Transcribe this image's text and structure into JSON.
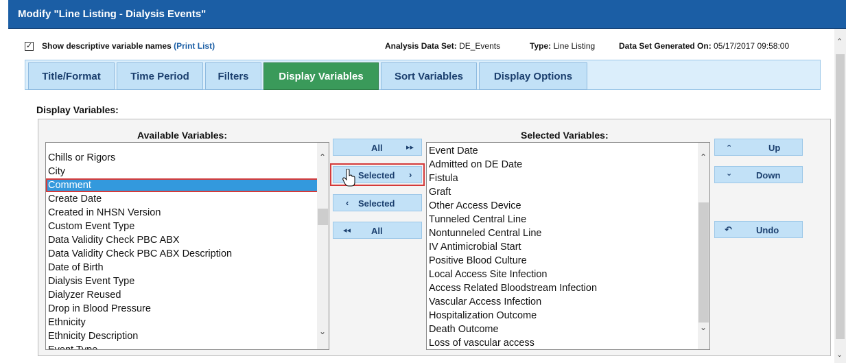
{
  "window": {
    "title": "Modify \"Line Listing - Dialysis Events\""
  },
  "infobar": {
    "checkbox_label": "Show descriptive variable names",
    "print_link": "(Print List)",
    "dataset_label": "Analysis Data Set:",
    "dataset_value": "DE_Events",
    "type_label": "Type:",
    "type_value": "Line Listing",
    "generated_label": "Data Set Generated On:",
    "generated_value": "05/17/2017 09:58:00"
  },
  "tabs": [
    {
      "label": "Title/Format"
    },
    {
      "label": "Time Period"
    },
    {
      "label": "Filters"
    },
    {
      "label": "Display Variables"
    },
    {
      "label": "Sort Variables"
    },
    {
      "label": "Display Options"
    }
  ],
  "section": {
    "title": "Display Variables:"
  },
  "available": {
    "title": "Available Variables:",
    "items": [
      "Chills or Rigors",
      "City",
      "Comment",
      "Create Date",
      "Created in NHSN Version",
      "Custom Event Type",
      "Data Validity Check PBC ABX",
      "Data Validity Check PBC ABX Description",
      "Date of Birth",
      "Dialysis Event Type",
      "Dialyzer Reused",
      "Drop in Blood Pressure",
      "Ethnicity",
      "Ethnicity Description",
      "Event Type"
    ],
    "selected_item": "Comment"
  },
  "transfer": {
    "all_right": "All",
    "selected_right": "Selected",
    "selected_left": "Selected",
    "all_left": "All"
  },
  "selected": {
    "title": "Selected Variables:",
    "items": [
      "Event Date",
      "Admitted on DE Date",
      "Fistula",
      "Graft",
      "Other Access Device",
      "Tunneled Central Line",
      "Nontunneled Central Line",
      "IV Antimicrobial Start",
      "Positive Blood Culture",
      "Local Access Site Infection",
      "Access Related Bloodstream Infection",
      "Vascular Access Infection",
      "Hospitalization Outcome",
      "Death Outcome",
      "Loss of vascular access"
    ]
  },
  "order": {
    "up": "Up",
    "down": "Down",
    "undo": "Undo"
  },
  "colors": {
    "header_blue": "#1b5ea5",
    "active_tab": "#3a9a5a",
    "tab_bg": "#c2e1f7",
    "selection": "#3399dd",
    "highlight_red": "#d43a3a"
  }
}
